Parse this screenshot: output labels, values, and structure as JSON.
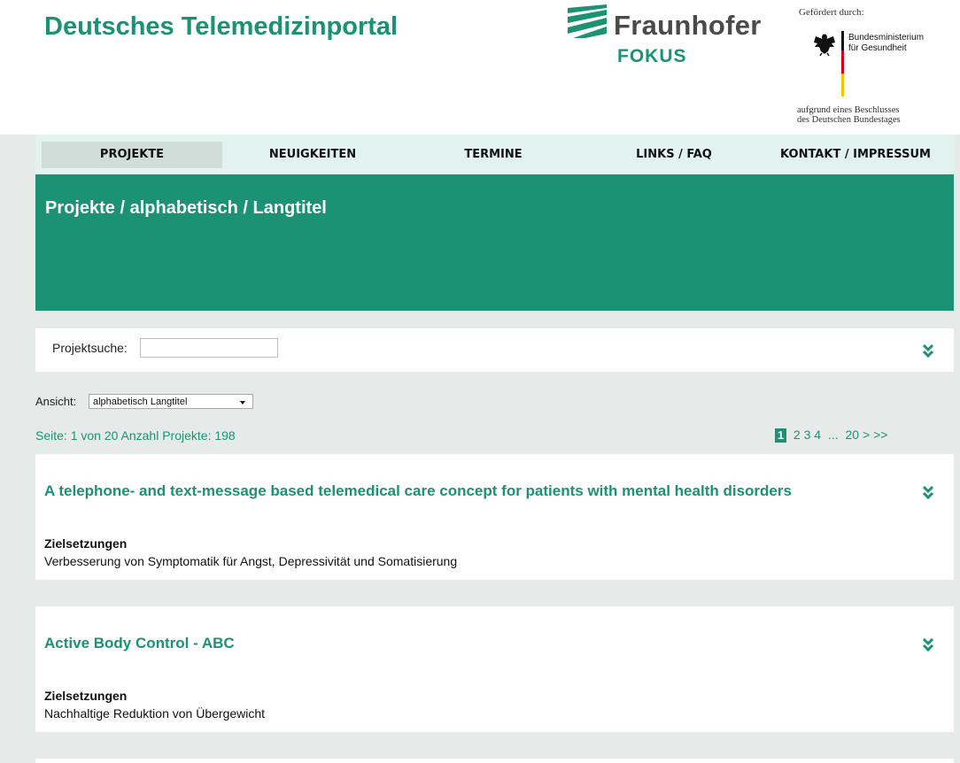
{
  "header": {
    "site_title": "Deutsches Telemedizinportal",
    "fraunhofer": {
      "name": "Fraunhofer",
      "sub": "FOKUS"
    },
    "sponsor": {
      "funded_by": "Gefördert durch:",
      "ministry_line1": "Bundesministerium",
      "ministry_line2": "für Gesundheit",
      "decision_line1": "aufgrund eines Beschlusses",
      "decision_line2": "des Deutschen Bundestages"
    }
  },
  "nav": {
    "items": [
      {
        "label": "PROJEKTE"
      },
      {
        "label": "NEUIGKEITEN"
      },
      {
        "label": "TERMINE"
      },
      {
        "label": "LINKS / FAQ"
      },
      {
        "label": "KONTAKT / IMPRESSUM"
      }
    ]
  },
  "banner": {
    "title": "Projekte / alphabetisch / Langtitel"
  },
  "search": {
    "label": "Projektsuche:",
    "value": "",
    "placeholder": ""
  },
  "view": {
    "label": "Ansicht:",
    "selected": "alphabetisch Langtitel"
  },
  "paging": {
    "info": "Seite: 1 von 20 Anzahl Projekte: 198",
    "current": "1",
    "pages": [
      "2",
      "3",
      "4"
    ],
    "ellipsis": "...",
    "last": "20",
    "next": ">",
    "next_all": ">>"
  },
  "projects": [
    {
      "title": "A telephone- and text-message based telemedical care concept for patients with mental health disorders",
      "goal_label": "Zielsetzungen",
      "goal_text": "Verbesserung von Symptomatik für Angst, Depressivität und Somatisierung"
    },
    {
      "title": "Active Body Control - ABC",
      "goal_label": "Zielsetzungen",
      "goal_text": "Nachhaltige Reduktion von Übergewicht"
    }
  ],
  "colors": {
    "accent": "#1a9273",
    "nav_bg": "#e2f2ee",
    "nav_active_bg": "#d0ddd8",
    "page_bg": "#e6ebe9"
  }
}
